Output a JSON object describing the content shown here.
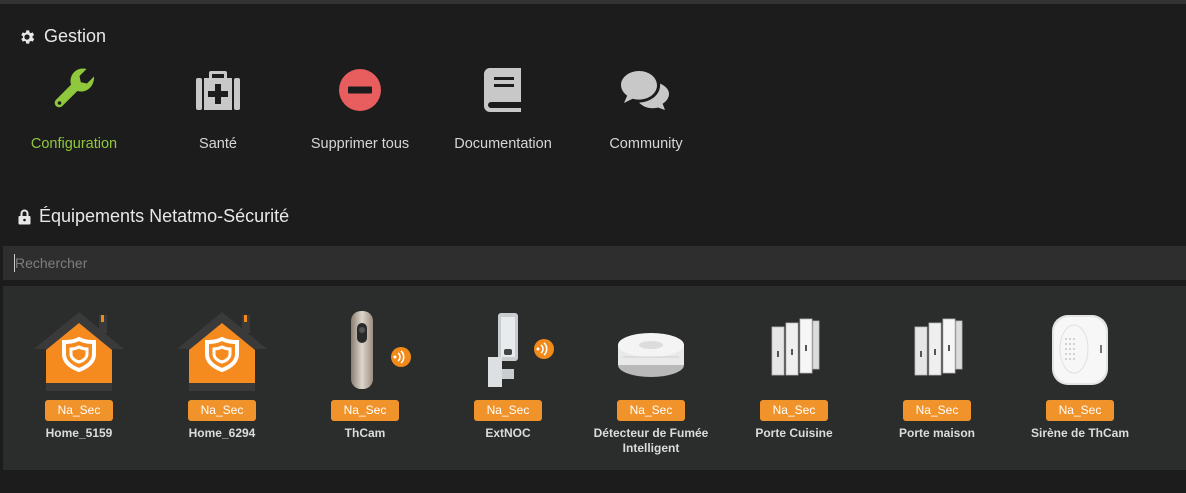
{
  "gestion": {
    "title": "Gestion",
    "icon": "gear-icon",
    "actions": [
      {
        "label": "Configuration",
        "icon": "wrench-icon",
        "color": "#8fc83c"
      },
      {
        "label": "Santé",
        "icon": "medical-bag-icon",
        "color": "#c8c8c8"
      },
      {
        "label": "Supprimer tous",
        "icon": "minus-circle-icon",
        "color": "#e85d5d"
      },
      {
        "label": "Documentation",
        "icon": "book-icon",
        "color": "#c8c8c8"
      },
      {
        "label": "Community",
        "icon": "comments-icon",
        "color": "#c8c8c8"
      }
    ]
  },
  "equipements": {
    "title": "Équipements Netatmo-Sécurité",
    "icon": "lock-icon",
    "search_placeholder": "Rechercher",
    "badge_color": "#f0932b",
    "devices": [
      {
        "badge": "Na_Sec",
        "name": "Home_5159",
        "icon": "home-shield-icon"
      },
      {
        "badge": "Na_Sec",
        "name": "Home_6294",
        "icon": "home-shield-icon"
      },
      {
        "badge": "Na_Sec",
        "name": "ThCam",
        "icon": "indoor-camera-icon"
      },
      {
        "badge": "Na_Sec",
        "name": "ExtNOC",
        "icon": "outdoor-camera-icon"
      },
      {
        "badge": "Na_Sec",
        "name": "Détecteur de Fumée Intelligent",
        "icon": "smoke-detector-icon"
      },
      {
        "badge": "Na_Sec",
        "name": "Porte Cuisine",
        "icon": "door-sensor-icon"
      },
      {
        "badge": "Na_Sec",
        "name": "Porte maison",
        "icon": "door-sensor-icon"
      },
      {
        "badge": "Na_Sec",
        "name": "Sirène de ThCam",
        "icon": "siren-icon"
      }
    ]
  }
}
